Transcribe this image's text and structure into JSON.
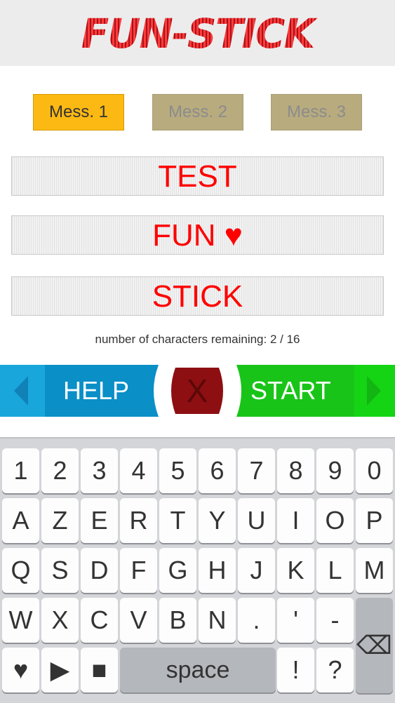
{
  "app": {
    "logo_text": "FUN-STICK"
  },
  "tabs": [
    {
      "label": "Mess. 1",
      "active": true
    },
    {
      "label": "Mess. 2",
      "active": false
    },
    {
      "label": "Mess. 3",
      "active": false
    }
  ],
  "messages": [
    {
      "text": "TEST"
    },
    {
      "text": "FUN ♥"
    },
    {
      "text": "STICK"
    }
  ],
  "status": {
    "remaining": "number of characters remaining: 2 / 16"
  },
  "actions": {
    "help_label": "HELP",
    "clear_label": "X",
    "start_label": "START"
  },
  "keyboard": {
    "row1": [
      "1",
      "2",
      "3",
      "4",
      "5",
      "6",
      "7",
      "8",
      "9",
      "0"
    ],
    "row2": [
      "A",
      "Z",
      "E",
      "R",
      "T",
      "Y",
      "U",
      "I",
      "O",
      "P"
    ],
    "row3": [
      "Q",
      "S",
      "D",
      "F",
      "G",
      "H",
      "J",
      "K",
      "L",
      "M"
    ],
    "row4": [
      "W",
      "X",
      "C",
      "V",
      "B",
      "N",
      ".",
      "'",
      "-"
    ],
    "row5": {
      "heart": "♥",
      "play": "▶",
      "stop": "■",
      "space": "space",
      "exclaim": "!",
      "question": "?"
    },
    "backspace": "⌫"
  },
  "colors": {
    "accent_yellow": "#fdb913",
    "help_blue": "#0a8fc7",
    "start_green": "#19c419",
    "clear_red": "#8d0f12",
    "message_text": "#ff0000"
  }
}
